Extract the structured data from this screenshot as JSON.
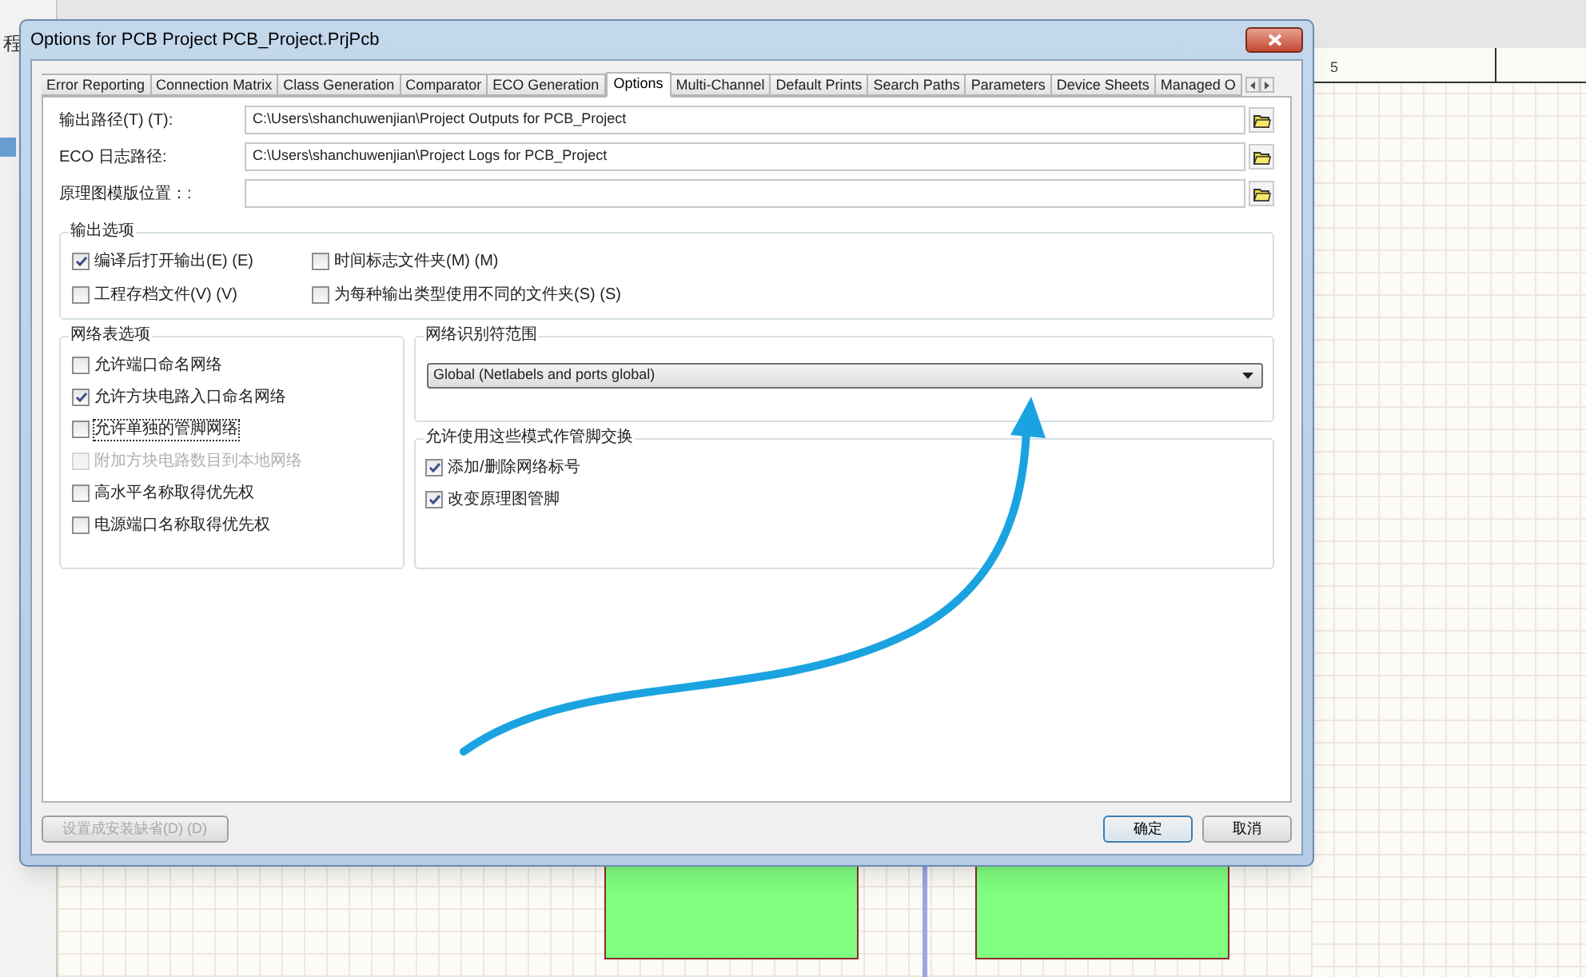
{
  "background": {
    "sidebar_label": "程",
    "sheet_header": "5"
  },
  "dialog": {
    "title": "Options for PCB Project PCB_Project.PrjPcb",
    "tabs": [
      {
        "label": "Error Reporting",
        "selected": false
      },
      {
        "label": "Connection Matrix",
        "selected": false
      },
      {
        "label": "Class Generation",
        "selected": false
      },
      {
        "label": "Comparator",
        "selected": false
      },
      {
        "label": "ECO Generation",
        "selected": false
      },
      {
        "label": "Options",
        "selected": true
      },
      {
        "label": "Multi-Channel",
        "selected": false
      },
      {
        "label": "Default Prints",
        "selected": false
      },
      {
        "label": "Search Paths",
        "selected": false
      },
      {
        "label": "Parameters",
        "selected": false
      },
      {
        "label": "Device Sheets",
        "selected": false
      },
      {
        "label": "Managed O",
        "selected": false
      }
    ],
    "paths": [
      {
        "label": "输出路径(T) (T):",
        "value": "C:\\Users\\shanchuwenjian\\Project Outputs for PCB_Project"
      },
      {
        "label": "ECO 日志路径:",
        "value": "C:\\Users\\shanchuwenjian\\Project Logs for PCB_Project"
      },
      {
        "label": "原理图模版位置：:"
      }
    ],
    "output_options": {
      "title": "输出选项",
      "items": [
        {
          "label": "编译后打开输出(E) (E)",
          "checked": true
        },
        {
          "label": "时间标志文件夹(M) (M)",
          "checked": false
        },
        {
          "label": "工程存档文件(V) (V)",
          "checked": false
        },
        {
          "label": "为每种输出类型使用不同的文件夹(S) (S)",
          "checked": false
        }
      ]
    },
    "netlist_options": {
      "title": "网络表选项",
      "items": [
        {
          "label": "允许端口命名网络",
          "checked": false,
          "disabled": false,
          "focused": false
        },
        {
          "label": "允许方块电路入口命名网络",
          "checked": true,
          "disabled": false,
          "focused": false
        },
        {
          "label": "允许单独的管脚网络",
          "checked": false,
          "disabled": false,
          "focused": true
        },
        {
          "label": "附加方块电路数目到本地网络",
          "checked": false,
          "disabled": true,
          "focused": false
        },
        {
          "label": "高水平名称取得优先权",
          "checked": false,
          "disabled": false,
          "focused": false
        },
        {
          "label": "电源端口名称取得优先权",
          "checked": false,
          "disabled": false,
          "focused": false
        }
      ]
    },
    "scope": {
      "title": "网络识别符范围",
      "value": "Global (Netlabels and ports global)"
    },
    "pin_swap": {
      "title": "允许使用这些模式作管脚交换",
      "items": [
        {
          "label": "添加/删除网络标号",
          "checked": true
        },
        {
          "label": "改变原理图管脚",
          "checked": true
        }
      ]
    },
    "buttons": [
      {
        "label": "设置成安装缺省(D) (D)",
        "disabled": true,
        "default": false
      },
      {
        "label": "确定",
        "disabled": false,
        "default": true
      },
      {
        "label": "取消",
        "disabled": false,
        "default": false
      }
    ]
  }
}
